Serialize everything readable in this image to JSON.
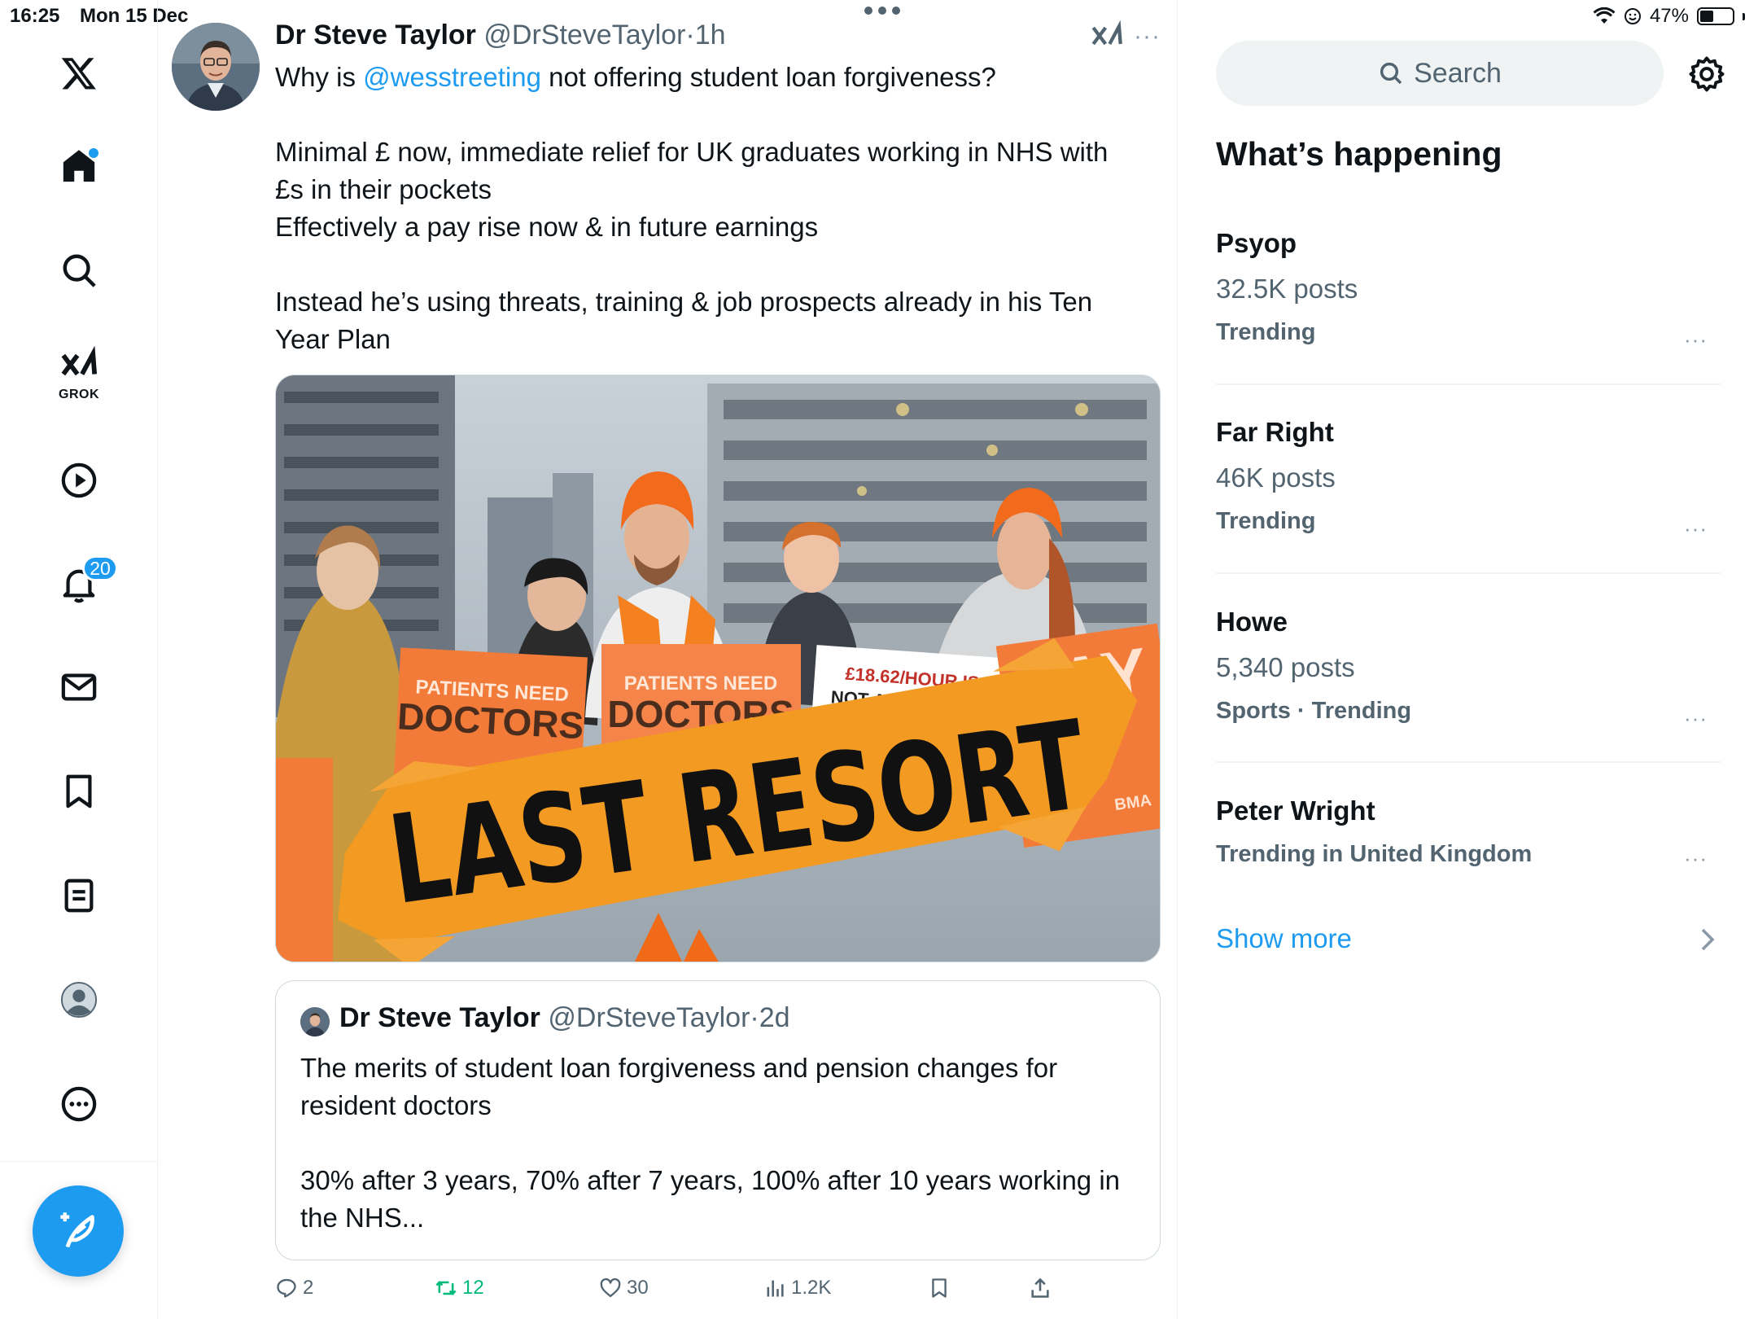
{
  "status_bar": {
    "time": "16:25",
    "date": "Mon 15 Dec",
    "battery": "47%",
    "battery_level": 0.47
  },
  "nav": {
    "notifications_badge": "20",
    "grok_label": "GROK"
  },
  "tweet": {
    "author_name": "Dr Steve Taylor",
    "author_handle": "@DrSteveTaylor",
    "separator": "·",
    "time": "1h",
    "more": "···",
    "text_prefix": "Why is ",
    "mention": "@wesstreeting",
    "text_suffix": " not offering student loan forgiveness?",
    "para2_line1": "Minimal £ now, immediate relief for UK graduates working in NHS with",
    "para2_line2": "£s in their pockets",
    "para2_line3": "Effectively a pay rise now & in future earnings",
    "para3_line1": "Instead he’s using threats, training & job prospects already in his Ten",
    "para3_line2": "Year Plan",
    "image": {
      "sign1": "PATIENTS NEED",
      "sign1b": "DOCTORS",
      "sign2": "PATIENTS NEED",
      "sign2b": "DOCTORS",
      "sign3": "£18.62/HOUR IS",
      "sign3b": "NOT A FAIR WAGE",
      "sign4": "PAY",
      "overlay": "LAST RESORT",
      "bma": "BMA"
    },
    "quote": {
      "author_name": "Dr Steve Taylor",
      "author_handle": "@DrSteveTaylor",
      "separator": "·",
      "time": "2d",
      "line1": "The merits of student loan forgiveness and pension changes for",
      "line2": "resident doctors",
      "line3": "30% after 3 years, 70% after 7 years, 100% after 10 years working in",
      "line4": "the NHS..."
    },
    "actions": {
      "replies": "2",
      "retweets": "12",
      "likes": "30",
      "views": "1.2K"
    }
  },
  "sidebar": {
    "search_placeholder": "Search",
    "heading": "What’s happening",
    "trends": [
      {
        "title": "Psyop",
        "count": "32.5K posts",
        "context": "Trending"
      },
      {
        "title": "Far Right",
        "count": "46K posts",
        "context": "Trending"
      },
      {
        "title": "Howe",
        "count": "5,340 posts",
        "context": "Sports · Trending"
      },
      {
        "title": "Peter Wright",
        "count": "",
        "context": "Trending in United Kingdom"
      }
    ],
    "trend_more": "···",
    "show_more": "Show more"
  },
  "colors": {
    "accent": "#1d9bf0",
    "text": "#0f1419",
    "muted": "#536471",
    "retweet": "#00ba7c",
    "orange": "#f26a1b"
  }
}
